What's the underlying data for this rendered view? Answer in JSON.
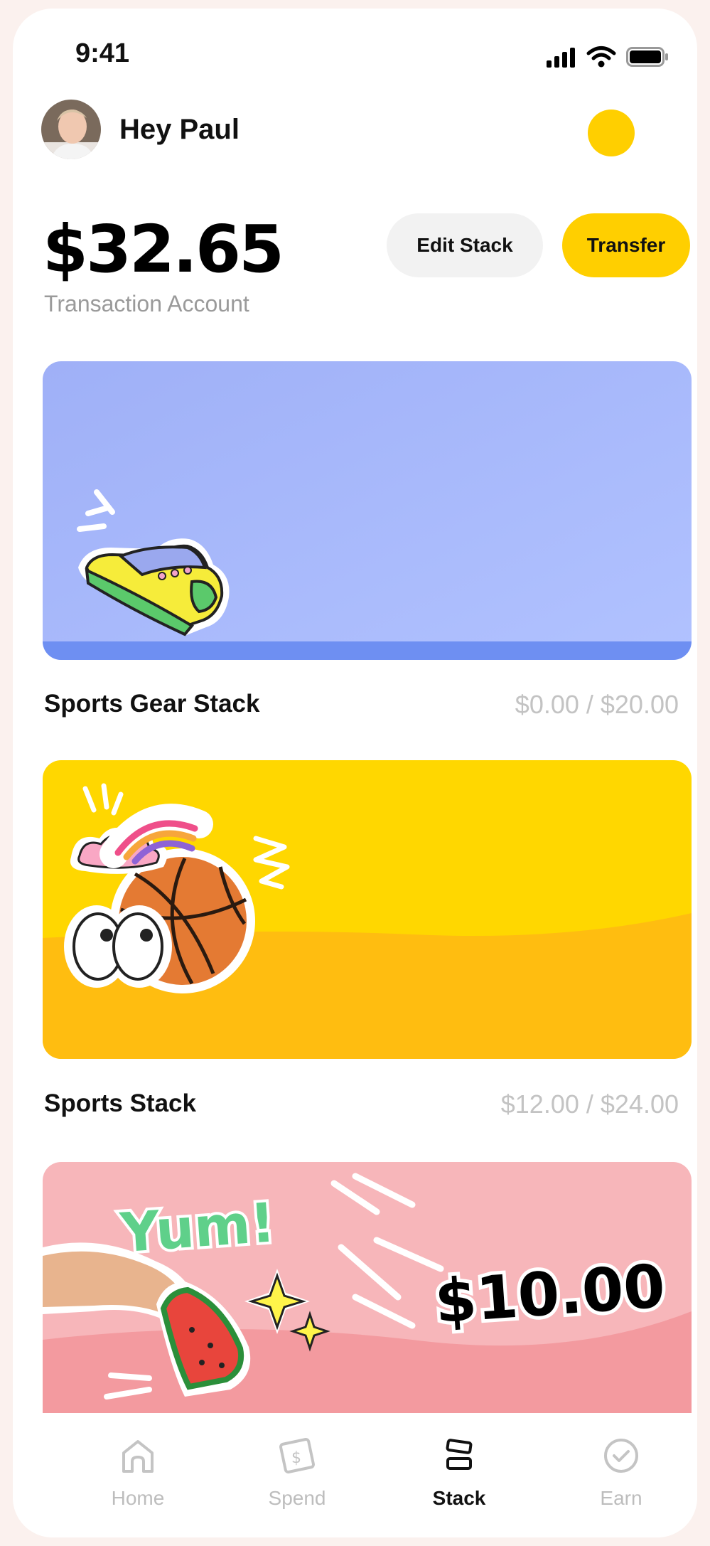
{
  "status": {
    "time": "9:41"
  },
  "header": {
    "greeting": "Hey Paul"
  },
  "account": {
    "balance": "$32.65",
    "label": "Transaction Account"
  },
  "actions": {
    "edit_label": "Edit Stack",
    "transfer_label": "Transfer"
  },
  "stacks": [
    {
      "title": "Sports Gear Stack",
      "amount": "$0.00 / $20.00"
    },
    {
      "title": "Sports Stack",
      "amount": "$12.00 / $24.00"
    },
    {
      "sticker_text": "Yum!",
      "amount_display": "$10.00"
    }
  ],
  "nav": [
    {
      "label": "Home",
      "icon": "home-icon"
    },
    {
      "label": "Spend",
      "icon": "dollar-note-icon"
    },
    {
      "label": "Stack",
      "icon": "stack-icon",
      "active": true
    },
    {
      "label": "Earn",
      "icon": "check-circle-icon"
    }
  ],
  "colors": {
    "accent": "#ffcf00",
    "card_blue": "#a8b8ff",
    "card_yellow": "#ffd700",
    "card_pink": "#f7b6ba"
  }
}
